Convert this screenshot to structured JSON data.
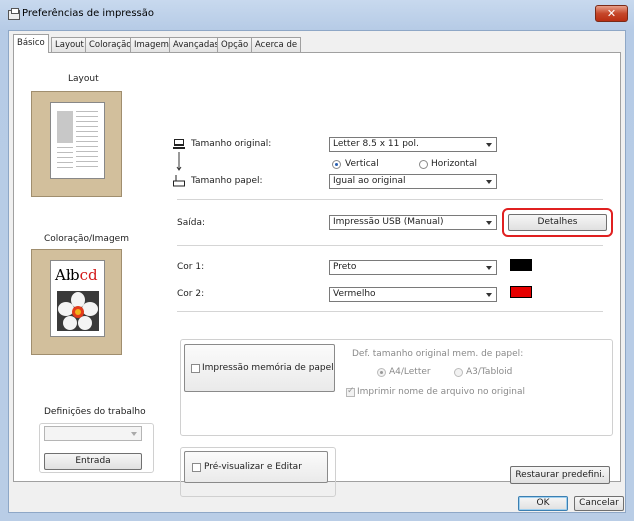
{
  "window": {
    "title": "Preferências de impressão",
    "close": "✕"
  },
  "tabs": [
    "Básico",
    "Layout",
    "Coloração",
    "Imagem",
    "Avançadas",
    "Opção",
    "Acerca de"
  ],
  "left": {
    "layout_heading": "Layout",
    "color_heading": "Coloração/Imagem",
    "color_preview_text": "Abcd",
    "job": {
      "heading": "Definições do trabalho",
      "select_value": "",
      "entrada_button": "Entrada"
    }
  },
  "paper": {
    "original_size_label": "Tamanho original:",
    "original_size_value": "Letter 8.5 x 11 pol.",
    "orientation_vertical": "Vertical",
    "orientation_horizontal": "Horizontal",
    "orientation_selected": "Vertical",
    "paper_size_label": "Tamanho papel:",
    "paper_size_value": "Igual ao original"
  },
  "output": {
    "label": "Saída:",
    "value": "Impressão USB (Manual)",
    "details_button": "Detalhes"
  },
  "colors": {
    "color1_label": "Cor 1:",
    "color1_value": "Preto",
    "color1_swatch": "#000000",
    "color2_label": "Cor 2:",
    "color2_value": "Vermelho",
    "color2_swatch": "#e60000"
  },
  "memory": {
    "checkbox_label": "Impressão memória de papel",
    "def_label": "Def. tamanho original mem. de papel:",
    "opt_a4": "A4/Letter",
    "opt_a3": "A3/Tabloid",
    "selected": "A4/Letter",
    "print_name_label": "Imprimir nome de arquivo no original",
    "print_name_checked": true
  },
  "preview": {
    "checkbox_label": "Pré-visualizar e Editar"
  },
  "restore_button": "Restaurar predefini.",
  "footer": {
    "ok": "OK",
    "cancel": "Cancelar"
  },
  "highlight_color": "#e02020",
  "accent": "#2a5fb0"
}
